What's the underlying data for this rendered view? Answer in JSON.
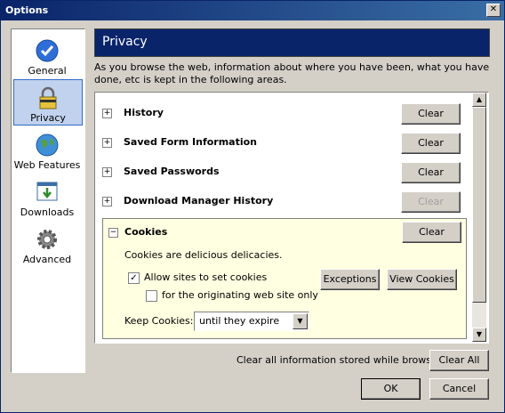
{
  "window": {
    "title": "Options",
    "close_glyph": "✕"
  },
  "sidebar": {
    "items": [
      {
        "label": "General",
        "icon": "checkmark-icon"
      },
      {
        "label": "Privacy",
        "icon": "padlock-icon",
        "selected": true
      },
      {
        "label": "Web Features",
        "icon": "globe-icon"
      },
      {
        "label": "Downloads",
        "icon": "download-icon"
      },
      {
        "label": "Advanced",
        "icon": "gear-icon"
      }
    ]
  },
  "header": {
    "title": "Privacy"
  },
  "description": "As you browse the web, information about where you have been, what you have done, etc is kept in the following areas.",
  "sections": [
    {
      "label": "History",
      "button": "Clear",
      "disabled": false
    },
    {
      "label": "Saved Form Information",
      "button": "Clear",
      "disabled": false
    },
    {
      "label": "Saved Passwords",
      "button": "Clear",
      "disabled": false
    },
    {
      "label": "Download Manager History",
      "button": "Clear",
      "disabled": true
    }
  ],
  "cookies": {
    "label": "Cookies",
    "clear_label": "Clear",
    "description": "Cookies are delicious delicacies.",
    "allow_label": "Allow sites to set cookies",
    "allow_checked": true,
    "origin_label": "for the originating web site only",
    "origin_checked": false,
    "exceptions_label": "Exceptions",
    "view_label": "View Cookies",
    "keep_label": "Keep Cookies:",
    "keep_value": "until they expire"
  },
  "footer": {
    "clear_all_text": "Clear all information stored while browsing:",
    "clear_all_label": "Clear All",
    "ok_label": "OK",
    "cancel_label": "Cancel"
  },
  "glyphs": {
    "expand": "+",
    "collapse": "−",
    "check": "✓",
    "up": "▲",
    "down": "▼"
  }
}
